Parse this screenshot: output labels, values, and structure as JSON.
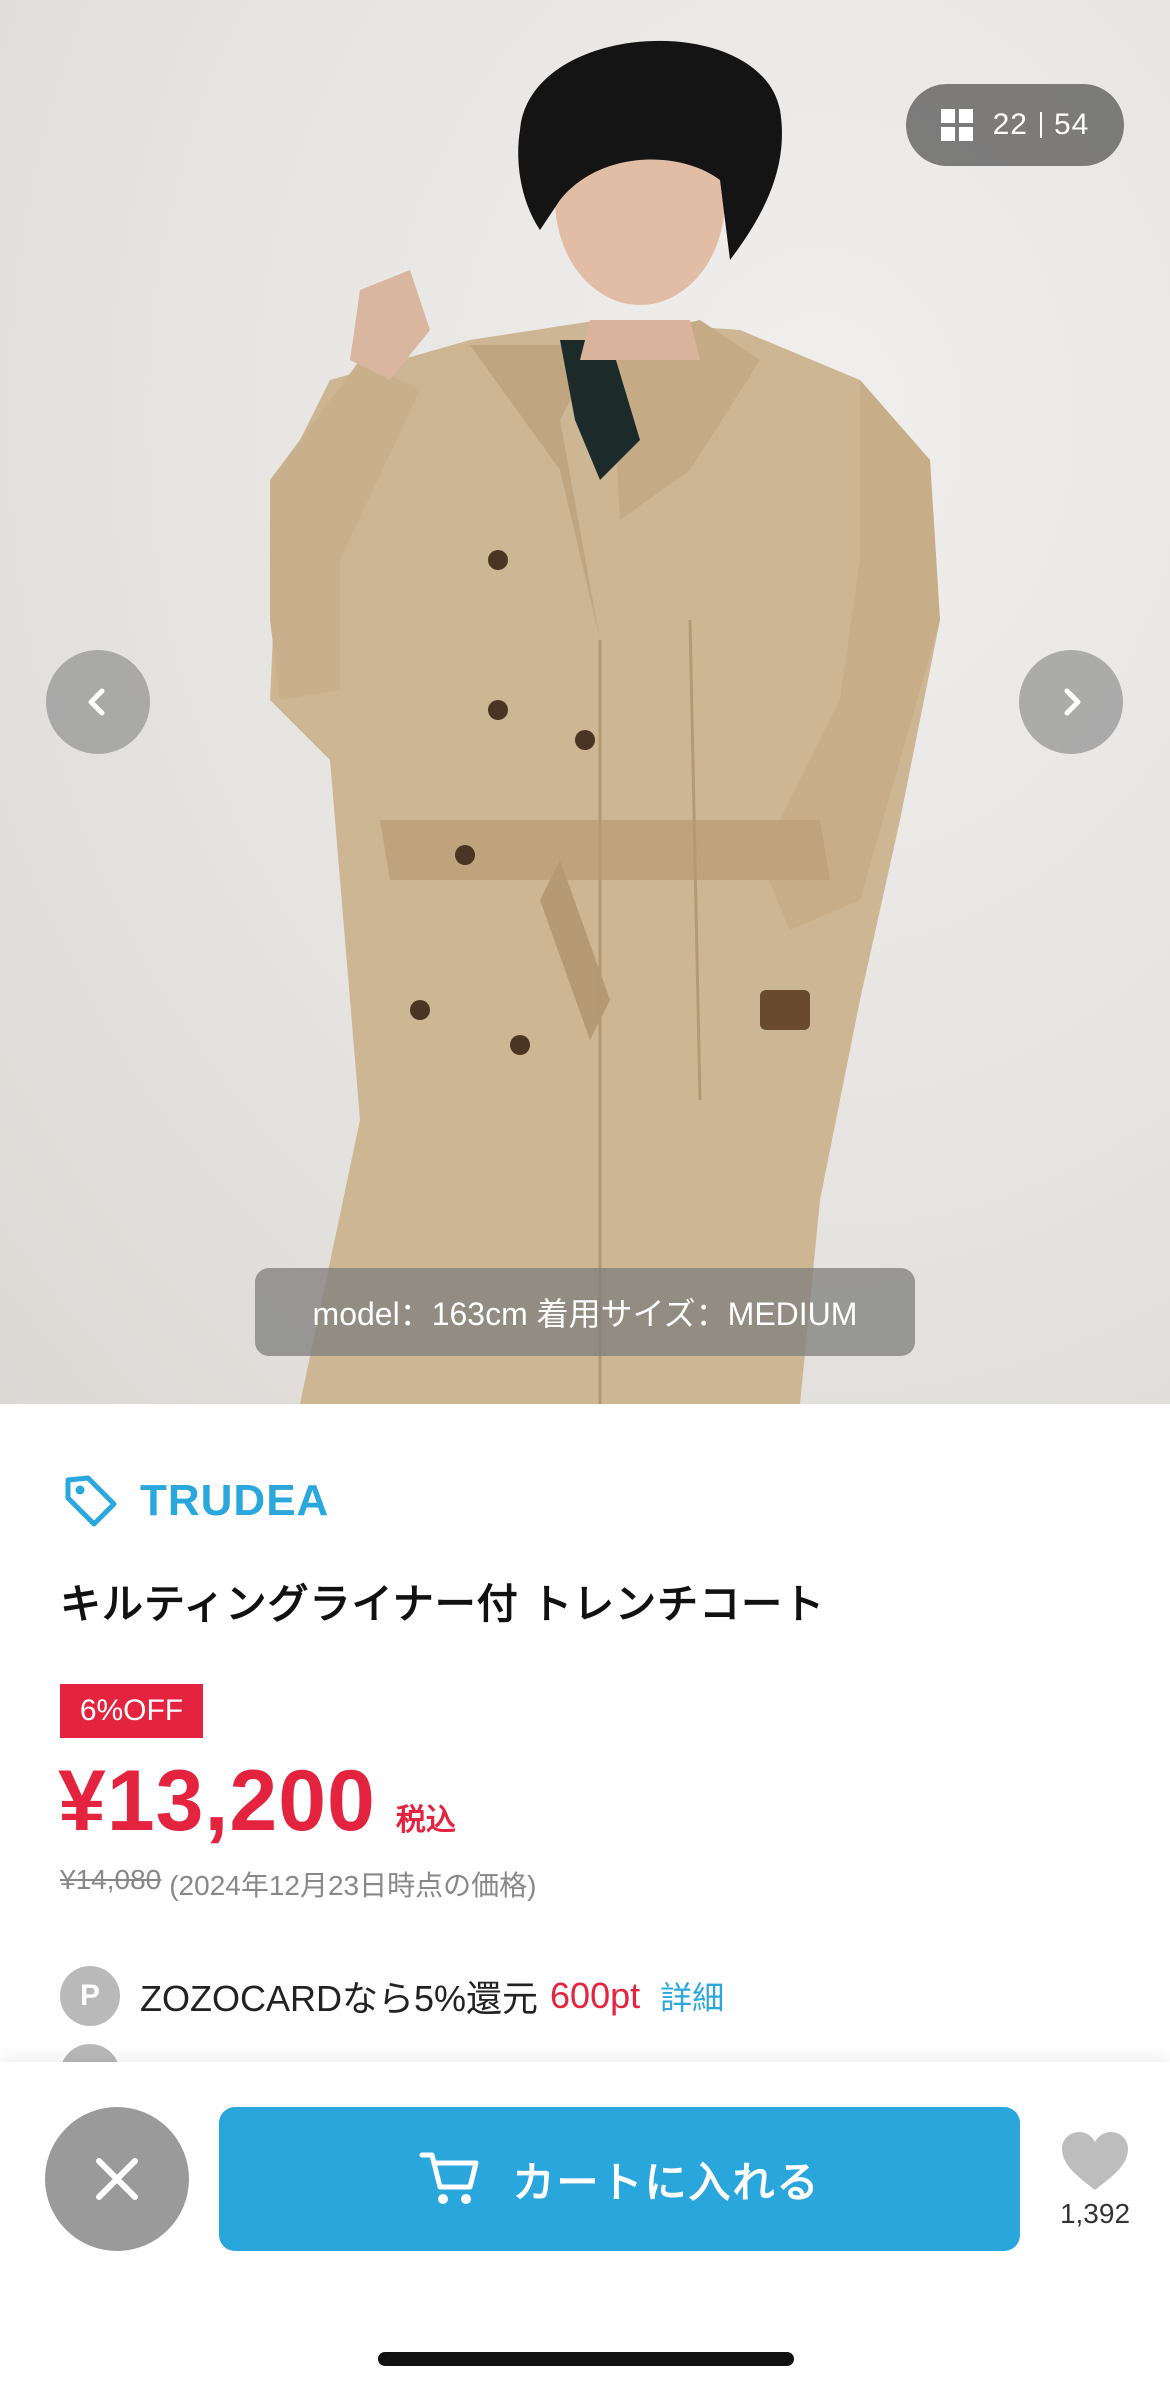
{
  "gallery": {
    "current": "22",
    "total": "54",
    "model_caption": "model：163cm 着用サイズ：MEDIUM"
  },
  "product": {
    "brand": "TRUDEA",
    "title": "キルティングライナー付 トレンチコート",
    "discount_badge": "6%OFF",
    "price": "¥13,200",
    "tax_label": "税込",
    "reference_price": "¥14,080",
    "reference_note": "(2024年12月23日時点の価格)"
  },
  "points": {
    "icon_letter": "P",
    "text": "ZOZOCARDなら5%還元",
    "amount": "600pt",
    "detail_link": "詳細"
  },
  "actions": {
    "cart_label": "カートに入れる",
    "favorite_count": "1,392"
  },
  "colors": {
    "brand_blue": "#2aa7dd",
    "sale_red": "#e4243f",
    "cart_button": "#29a7dd",
    "close_button": "#9a9a9a"
  },
  "icons": [
    "grid-icon",
    "chevron-left-icon",
    "chevron-right-icon",
    "tag-icon",
    "close-icon",
    "cart-icon",
    "heart-icon"
  ]
}
